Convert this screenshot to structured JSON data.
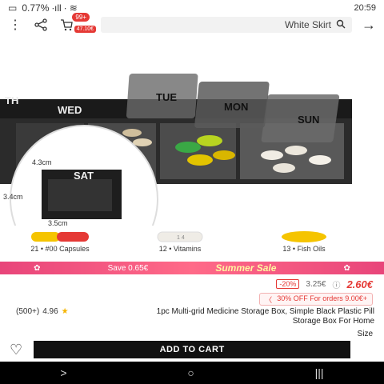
{
  "status": {
    "time": "20:59",
    "indicators": "0.77% ∙ıll ∙ ≋"
  },
  "header": {
    "search_text": "White Skirt",
    "cart_badge": "99+",
    "cart_sub": "47.10€"
  },
  "product_image": {
    "lids": [
      "SUN",
      "MON",
      "TUE"
    ],
    "base_labels": [
      "WED",
      "TH"
    ],
    "inset": {
      "label": "SAT",
      "dim_width": "4.3cm",
      "dim_height": "3.4cm",
      "dim_depth": "3.5cm"
    }
  },
  "thumbnails": [
    {
      "label": "13 • Fish Oils",
      "color": "#f5c400"
    },
    {
      "label": "12 • Vitamins",
      "color": "#f2f0ea"
    },
    {
      "label": "21 • #00 Capsules",
      "color": "#e53935"
    }
  ],
  "banner": {
    "title": "Summer Sale",
    "save_text": "Save 0.65€"
  },
  "price": {
    "current": "2.60€",
    "original": "3.25€",
    "discount": "-20%"
  },
  "promo": {
    "text": "30% OFF For orders 9.00€+",
    "chevron": "〈"
  },
  "product": {
    "title": "1pc Multi-grid Medicine Storage Box, Simple Black Plastic Pill Storage Box For Home",
    "rating": "4.96",
    "reviews": "(500+)"
  },
  "size_label": "Size",
  "actions": {
    "add_to_cart": "ADD TO CART"
  },
  "colors": {
    "accent": "#e53935",
    "banner": "#ff6a88",
    "black": "#111111"
  }
}
